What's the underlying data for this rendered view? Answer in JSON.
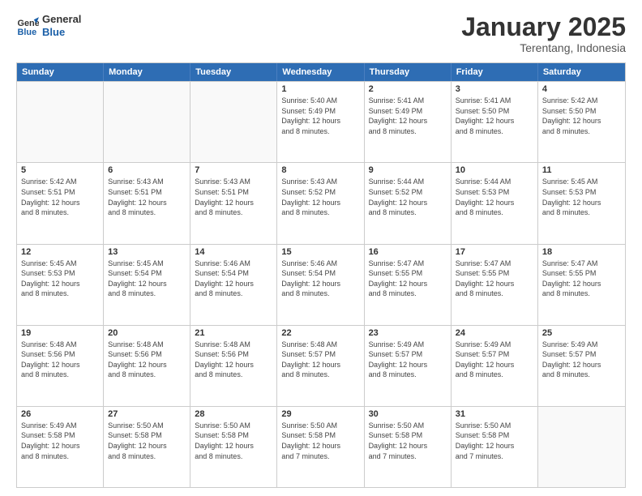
{
  "logo": {
    "line1": "General",
    "line2": "Blue"
  },
  "title": "January 2025",
  "subtitle": "Terentang, Indonesia",
  "header_days": [
    "Sunday",
    "Monday",
    "Tuesday",
    "Wednesday",
    "Thursday",
    "Friday",
    "Saturday"
  ],
  "weeks": [
    [
      {
        "day": "",
        "info": ""
      },
      {
        "day": "",
        "info": ""
      },
      {
        "day": "",
        "info": ""
      },
      {
        "day": "1",
        "info": "Sunrise: 5:40 AM\nSunset: 5:49 PM\nDaylight: 12 hours\nand 8 minutes."
      },
      {
        "day": "2",
        "info": "Sunrise: 5:41 AM\nSunset: 5:49 PM\nDaylight: 12 hours\nand 8 minutes."
      },
      {
        "day": "3",
        "info": "Sunrise: 5:41 AM\nSunset: 5:50 PM\nDaylight: 12 hours\nand 8 minutes."
      },
      {
        "day": "4",
        "info": "Sunrise: 5:42 AM\nSunset: 5:50 PM\nDaylight: 12 hours\nand 8 minutes."
      }
    ],
    [
      {
        "day": "5",
        "info": "Sunrise: 5:42 AM\nSunset: 5:51 PM\nDaylight: 12 hours\nand 8 minutes."
      },
      {
        "day": "6",
        "info": "Sunrise: 5:43 AM\nSunset: 5:51 PM\nDaylight: 12 hours\nand 8 minutes."
      },
      {
        "day": "7",
        "info": "Sunrise: 5:43 AM\nSunset: 5:51 PM\nDaylight: 12 hours\nand 8 minutes."
      },
      {
        "day": "8",
        "info": "Sunrise: 5:43 AM\nSunset: 5:52 PM\nDaylight: 12 hours\nand 8 minutes."
      },
      {
        "day": "9",
        "info": "Sunrise: 5:44 AM\nSunset: 5:52 PM\nDaylight: 12 hours\nand 8 minutes."
      },
      {
        "day": "10",
        "info": "Sunrise: 5:44 AM\nSunset: 5:53 PM\nDaylight: 12 hours\nand 8 minutes."
      },
      {
        "day": "11",
        "info": "Sunrise: 5:45 AM\nSunset: 5:53 PM\nDaylight: 12 hours\nand 8 minutes."
      }
    ],
    [
      {
        "day": "12",
        "info": "Sunrise: 5:45 AM\nSunset: 5:53 PM\nDaylight: 12 hours\nand 8 minutes."
      },
      {
        "day": "13",
        "info": "Sunrise: 5:45 AM\nSunset: 5:54 PM\nDaylight: 12 hours\nand 8 minutes."
      },
      {
        "day": "14",
        "info": "Sunrise: 5:46 AM\nSunset: 5:54 PM\nDaylight: 12 hours\nand 8 minutes."
      },
      {
        "day": "15",
        "info": "Sunrise: 5:46 AM\nSunset: 5:54 PM\nDaylight: 12 hours\nand 8 minutes."
      },
      {
        "day": "16",
        "info": "Sunrise: 5:47 AM\nSunset: 5:55 PM\nDaylight: 12 hours\nand 8 minutes."
      },
      {
        "day": "17",
        "info": "Sunrise: 5:47 AM\nSunset: 5:55 PM\nDaylight: 12 hours\nand 8 minutes."
      },
      {
        "day": "18",
        "info": "Sunrise: 5:47 AM\nSunset: 5:55 PM\nDaylight: 12 hours\nand 8 minutes."
      }
    ],
    [
      {
        "day": "19",
        "info": "Sunrise: 5:48 AM\nSunset: 5:56 PM\nDaylight: 12 hours\nand 8 minutes."
      },
      {
        "day": "20",
        "info": "Sunrise: 5:48 AM\nSunset: 5:56 PM\nDaylight: 12 hours\nand 8 minutes."
      },
      {
        "day": "21",
        "info": "Sunrise: 5:48 AM\nSunset: 5:56 PM\nDaylight: 12 hours\nand 8 minutes."
      },
      {
        "day": "22",
        "info": "Sunrise: 5:48 AM\nSunset: 5:57 PM\nDaylight: 12 hours\nand 8 minutes."
      },
      {
        "day": "23",
        "info": "Sunrise: 5:49 AM\nSunset: 5:57 PM\nDaylight: 12 hours\nand 8 minutes."
      },
      {
        "day": "24",
        "info": "Sunrise: 5:49 AM\nSunset: 5:57 PM\nDaylight: 12 hours\nand 8 minutes."
      },
      {
        "day": "25",
        "info": "Sunrise: 5:49 AM\nSunset: 5:57 PM\nDaylight: 12 hours\nand 8 minutes."
      }
    ],
    [
      {
        "day": "26",
        "info": "Sunrise: 5:49 AM\nSunset: 5:58 PM\nDaylight: 12 hours\nand 8 minutes."
      },
      {
        "day": "27",
        "info": "Sunrise: 5:50 AM\nSunset: 5:58 PM\nDaylight: 12 hours\nand 8 minutes."
      },
      {
        "day": "28",
        "info": "Sunrise: 5:50 AM\nSunset: 5:58 PM\nDaylight: 12 hours\nand 8 minutes."
      },
      {
        "day": "29",
        "info": "Sunrise: 5:50 AM\nSunset: 5:58 PM\nDaylight: 12 hours\nand 7 minutes."
      },
      {
        "day": "30",
        "info": "Sunrise: 5:50 AM\nSunset: 5:58 PM\nDaylight: 12 hours\nand 7 minutes."
      },
      {
        "day": "31",
        "info": "Sunrise: 5:50 AM\nSunset: 5:58 PM\nDaylight: 12 hours\nand 7 minutes."
      },
      {
        "day": "",
        "info": ""
      }
    ]
  ]
}
